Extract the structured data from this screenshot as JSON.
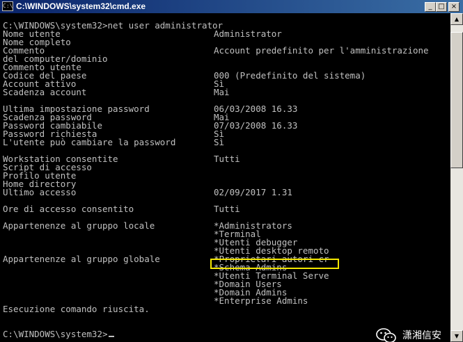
{
  "window": {
    "title": "C:\\WINDOWS\\system32\\cmd.exe",
    "icon_label": "C:\\",
    "minimize_glyph": "_",
    "maximize_glyph": "□",
    "close_glyph": "×"
  },
  "console": {
    "lines": [
      {
        "left": "C:\\WINDOWS\\system32>net user administrator",
        "right": ""
      },
      {
        "left": "Nome utente",
        "right": "Administrator"
      },
      {
        "left": "Nome completo",
        "right": ""
      },
      {
        "left": "Commento",
        "right": "Account predefinito per l'amministrazione"
      },
      {
        "left": "del computer/dominio",
        "right": ""
      },
      {
        "left": "Commento utente",
        "right": ""
      },
      {
        "left": "Codice del paese",
        "right": "000 (Predefinito del sistema)"
      },
      {
        "left": "Account attivo",
        "right": "Sì"
      },
      {
        "left": "Scadenza account",
        "right": "Mai"
      },
      {
        "left": "",
        "right": ""
      },
      {
        "left": "Ultima impostazione password",
        "right": "06/03/2008 16.33"
      },
      {
        "left": "Scadenza password",
        "right": "Mai"
      },
      {
        "left": "Password cambiabile",
        "right": "07/03/2008 16.33"
      },
      {
        "left": "Password richiesta",
        "right": "Sì"
      },
      {
        "left": "L'utente può cambiare la password",
        "right": "Sì"
      },
      {
        "left": "",
        "right": ""
      },
      {
        "left": "Workstation consentite",
        "right": "Tutti"
      },
      {
        "left": "Script di accesso",
        "right": ""
      },
      {
        "left": "Profilo utente",
        "right": ""
      },
      {
        "left": "Home directory",
        "right": ""
      },
      {
        "left": "Ultimo accesso",
        "right": "02/09/2017 1.31"
      },
      {
        "left": "",
        "right": ""
      },
      {
        "left": "Ore di accesso consentito",
        "right": "Tutti"
      },
      {
        "left": "",
        "right": ""
      },
      {
        "left": "Appartenenze al gruppo locale",
        "right": "*Administrators"
      },
      {
        "left": "",
        "right": "*Terminal"
      },
      {
        "left": "",
        "right": "*Utenti debugger"
      },
      {
        "left": "",
        "right": "*Utenti desktop remoto"
      },
      {
        "left": "Appartenenze al gruppo globale",
        "right": "*Proprietari autori cr"
      },
      {
        "left": "",
        "right": "*Schema Admins"
      },
      {
        "left": "",
        "right": "*Utenti Terminal Serve"
      },
      {
        "left": "",
        "right": "*Domain Users"
      },
      {
        "left": "",
        "right": "*Domain Admins"
      },
      {
        "left": "",
        "right": "*Enterprise Admins"
      },
      {
        "left": "Esecuzione comando riuscita.",
        "right": ""
      },
      {
        "left": "",
        "right": ""
      },
      {
        "left": "",
        "right": ""
      },
      {
        "left": "C:\\WINDOWS\\system32>",
        "right": ""
      }
    ]
  },
  "watermark": {
    "text": "潇湘信安",
    "icon": "wechat-icon"
  },
  "colors": {
    "console_bg": "#000000",
    "console_text": "#c0c0c0",
    "highlight": "#f5e800"
  }
}
